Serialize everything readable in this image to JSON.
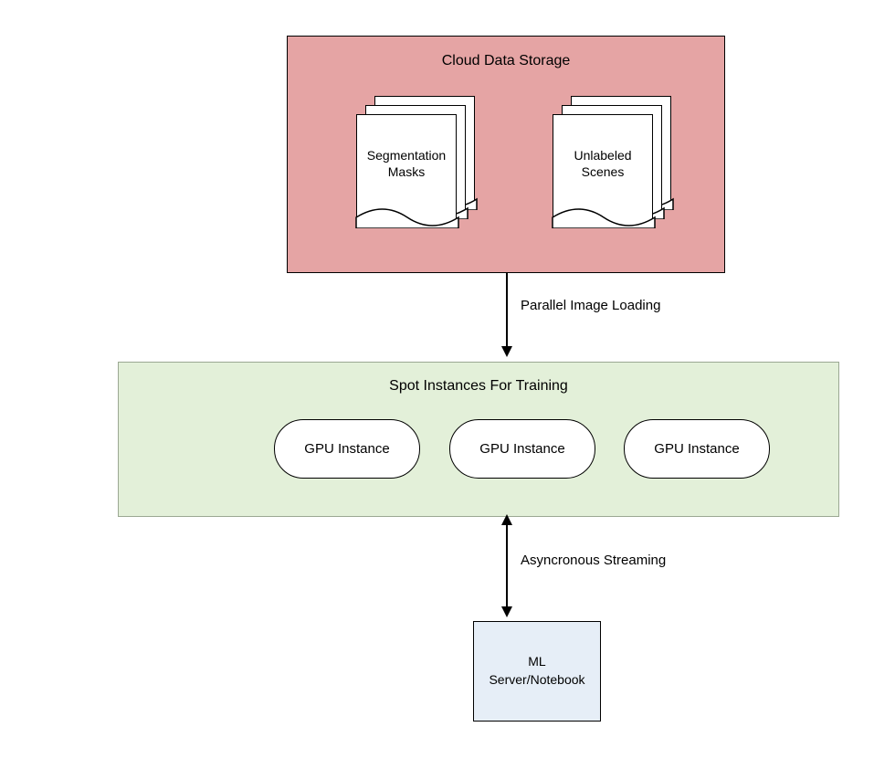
{
  "storage": {
    "title": "Cloud Data Storage",
    "doc1_line1": "Segmentation",
    "doc1_line2": "Masks",
    "doc2_line1": "Unlabeled",
    "doc2_line2": "Scenes"
  },
  "training": {
    "title": "Spot Instances For Training",
    "gpu1": "GPU Instance",
    "gpu2": "GPU Instance",
    "gpu3": "GPU Instance"
  },
  "notebook": {
    "line1": "ML",
    "line2": "Server/Notebook"
  },
  "edges": {
    "label1": "Parallel Image Loading",
    "label2": "Asyncronous Streaming"
  }
}
